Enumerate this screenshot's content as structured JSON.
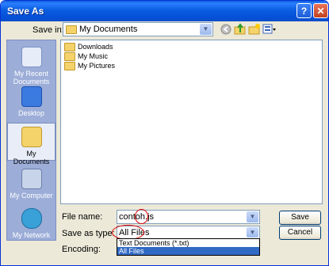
{
  "window": {
    "title": "Save As",
    "help_glyph": "?",
    "close_glyph": "✕"
  },
  "save_in": {
    "label": "Save in:",
    "value": "My Documents"
  },
  "places": [
    {
      "label": "My Recent Documents"
    },
    {
      "label": "Desktop"
    },
    {
      "label": "My Documents"
    },
    {
      "label": "My Computer"
    },
    {
      "label": "My Network"
    }
  ],
  "files": [
    {
      "name": "Downloads"
    },
    {
      "name": "My Music"
    },
    {
      "name": "My Pictures"
    }
  ],
  "file_name": {
    "label": "File name:",
    "value": "contoh.js"
  },
  "save_as_type": {
    "label": "Save as type:",
    "value": "All Files",
    "options": [
      "Text Documents (*.txt)",
      "All Files"
    ]
  },
  "encoding": {
    "label": "Encoding:"
  },
  "buttons": {
    "save": "Save",
    "cancel": "Cancel"
  },
  "icons": {
    "back": "back-icon",
    "up": "up-folder-icon",
    "new_folder": "new-folder-icon",
    "views": "views-menu-icon"
  }
}
